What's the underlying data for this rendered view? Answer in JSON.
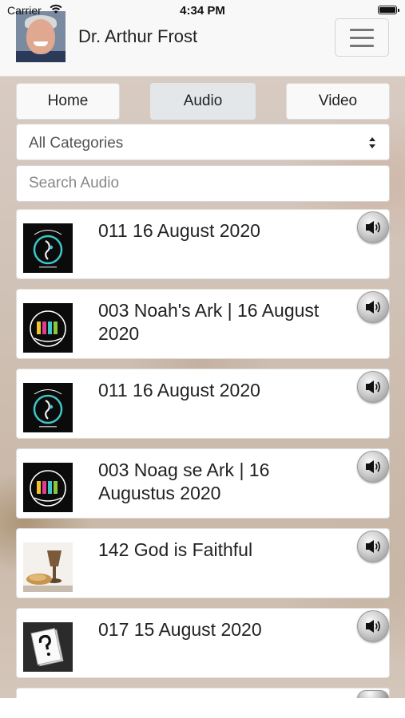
{
  "status_bar": {
    "carrier": "Carrier",
    "time": "4:34 PM"
  },
  "header": {
    "title": "Dr. Arthur Frost"
  },
  "tabs": [
    {
      "label": "Home",
      "active": false
    },
    {
      "label": "Audio",
      "active": true
    },
    {
      "label": "Video",
      "active": false
    }
  ],
  "category_select": {
    "value": "All Categories"
  },
  "search": {
    "placeholder": "Search Audio"
  },
  "items": [
    {
      "title": "011 16 August 2020",
      "thumbnail": "fathers-heart-church-logo"
    },
    {
      "title": "003 Noah's Ark | 16 August 2020",
      "thumbnail": "fathers-heart-kidz-logo"
    },
    {
      "title": "011 16 August 2020",
      "thumbnail": "fathers-heart-church-logo"
    },
    {
      "title": "003 Noag se Ark | 16 Augustus 2020",
      "thumbnail": "fathers-heart-kidz-logo"
    },
    {
      "title": "142 God is Faithful",
      "thumbnail": "communion-bread-cup-image"
    },
    {
      "title": "017 15 August 2020",
      "thumbnail": "question-mark-cards-image"
    }
  ],
  "icons": {
    "menu": "hamburger-menu-icon",
    "audio": "speaker-icon",
    "select": "sort-arrows-icon"
  },
  "colors": {
    "active_tab": "#e3e7ea",
    "logo_teal": "#3ec6c8",
    "kidz_pink": "#e23d8c"
  }
}
